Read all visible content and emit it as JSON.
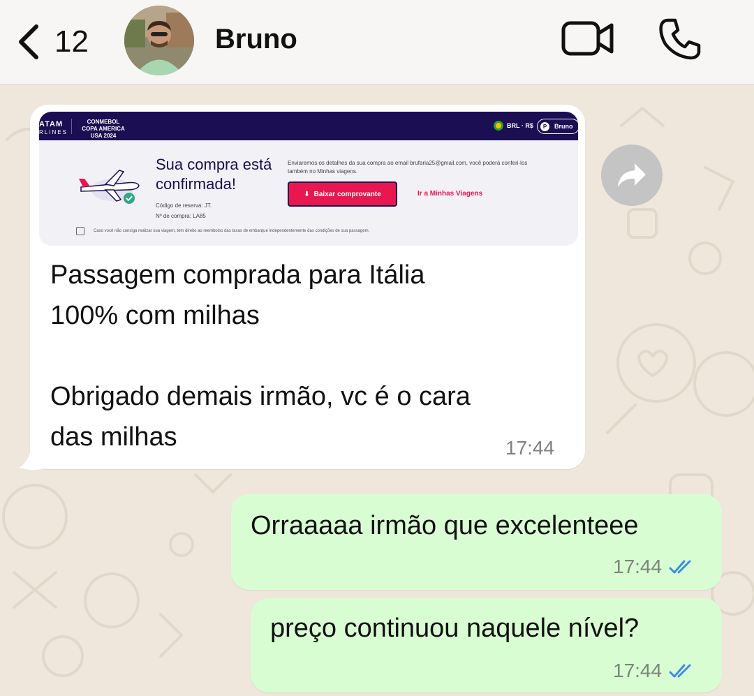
{
  "header": {
    "back_count": "12",
    "contact_name": "Bruno"
  },
  "colors": {
    "outgoing_bubble": "#d9fdd3",
    "incoming_bubble": "#ffffff",
    "chat_background": "#efe7dc",
    "read_ticks": "#3b8fe0"
  },
  "icons": [
    "back-chevron-icon",
    "video-call-icon",
    "phone-call-icon",
    "forward-icon",
    "double-check-icon"
  ],
  "preview": {
    "brand_line1": "ATAM",
    "brand_line2": "RLINES",
    "copa_label": "CONMEBOL COPA AMERICA USA 2024",
    "currency": "BRL · R$",
    "user_name": "Bruno",
    "title_line1": "Sua compra está",
    "title_line2": "confirmada!",
    "reserva_label": "Código de reserva: JT.",
    "compra_label": "Nº de compra: LA85",
    "detail_text": "Enviaremos os detalhes da sua compra ao email brufaria25@gmail.com, você poderá conferi-los também no Minhas viagens.",
    "download_button": "Baixar comprovante",
    "minhas_link": "Ir a Minhas Viagens",
    "notice": "Caso você não consiga realizar sua viagem, tem direito ao reembolso das taxas de embarque independentemente das condições de sua passagem."
  },
  "messages": [
    {
      "direction": "in",
      "text": "Passagem comprada para Itália\n100% com milhas\n\nObrigado demais irmão, vc é o cara\ndas milhas",
      "time": "17:44"
    },
    {
      "direction": "out",
      "text": "Orraaaaa irmão que excelenteee",
      "time": "17:44",
      "status": "read"
    },
    {
      "direction": "out",
      "text": "preço continuou naquele nível?",
      "time": "17:44",
      "status": "read"
    }
  ]
}
